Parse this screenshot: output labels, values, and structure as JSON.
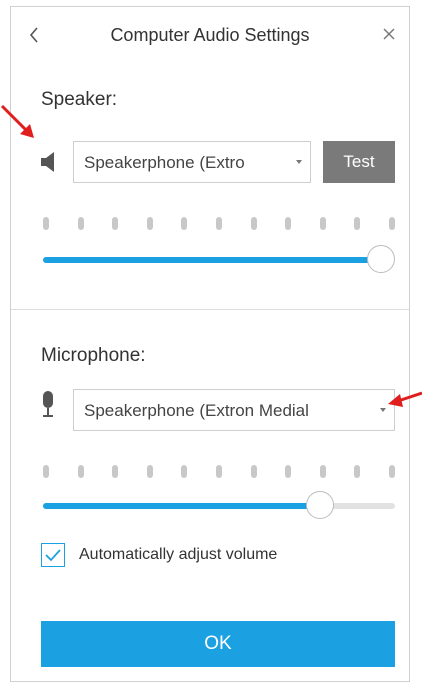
{
  "window": {
    "title": "Computer Audio Settings",
    "back_icon": "chevron-left-icon",
    "close_icon": "close-icon"
  },
  "speaker": {
    "label": "Speaker:",
    "device": "Speakerphone (Extro",
    "test_label": "Test",
    "volume": 1.0
  },
  "microphone": {
    "label": "Microphone:",
    "device": "Speakerphone (Extron Medial",
    "volume": 0.82
  },
  "auto_adjust": {
    "label": "Automatically adjust volume",
    "checked": true
  },
  "ok_label": "OK",
  "colors": {
    "accent": "#1ba1e2",
    "test_button": "#7a7a7a",
    "annotation_arrow": "#e01e1e"
  }
}
